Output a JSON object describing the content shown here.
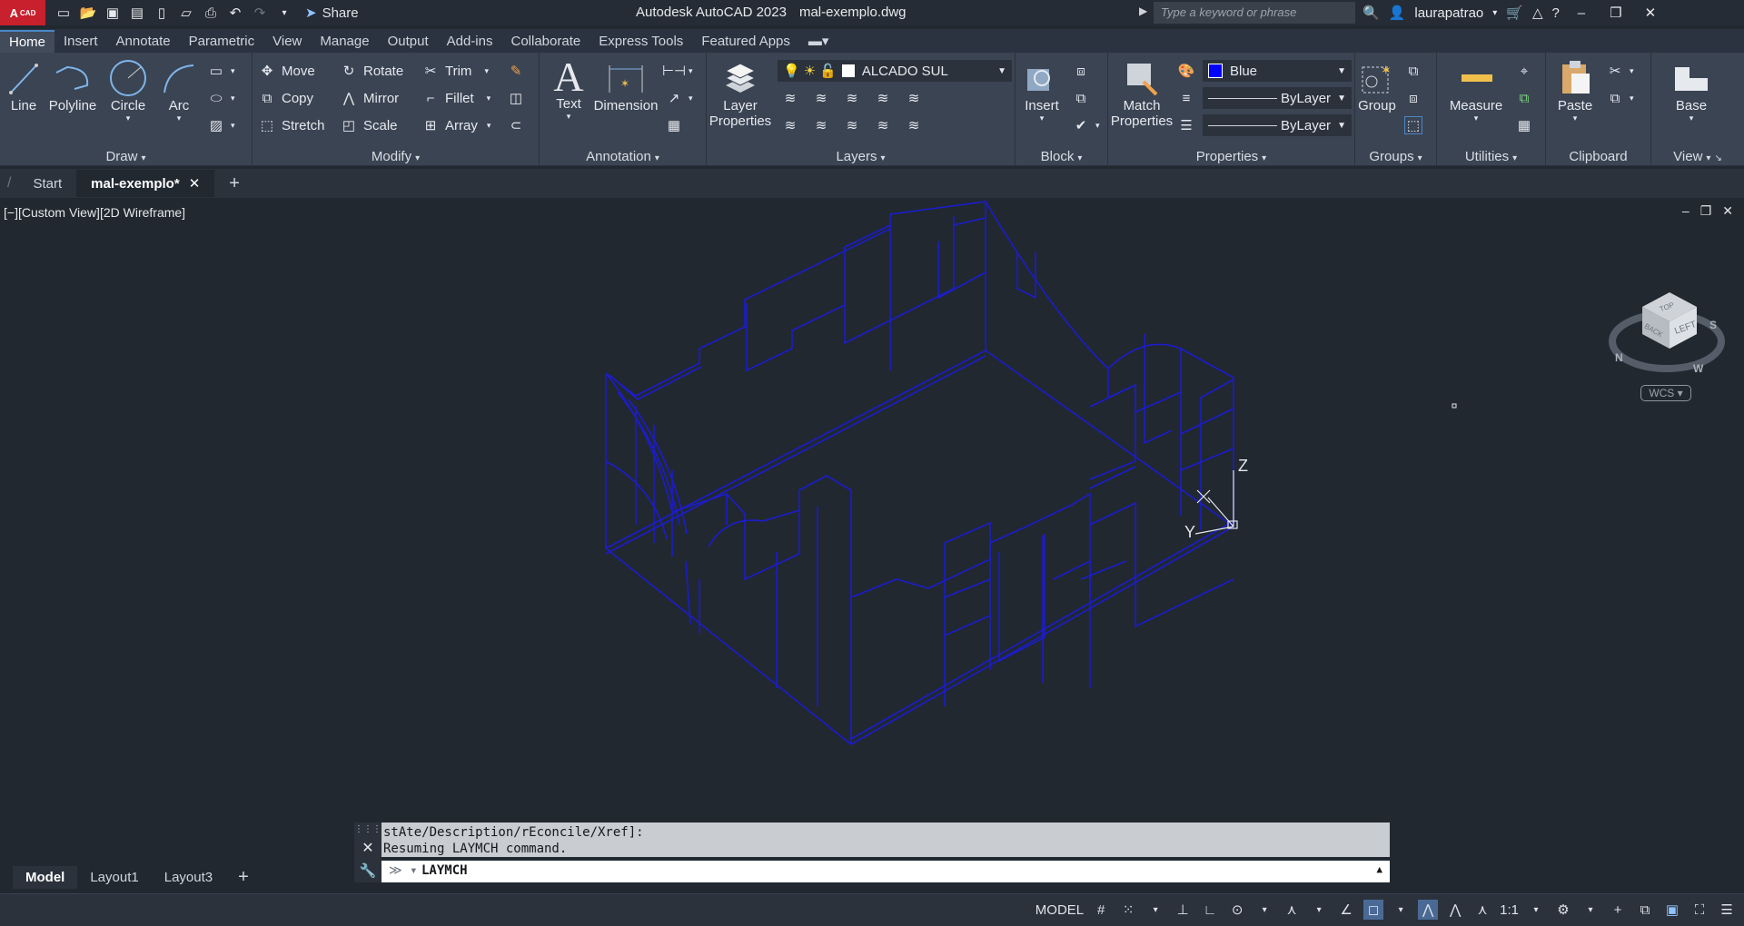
{
  "app": {
    "logo_text": "A",
    "logo_sub": "CAD",
    "title": "Autodesk AutoCAD 2023",
    "filename": "mal-exemplo.dwg",
    "share_label": "Share",
    "search_placeholder": "Type a keyword or phrase",
    "user": "laurapatrao"
  },
  "ribbon_tabs": [
    "Home",
    "Insert",
    "Annotate",
    "Parametric",
    "View",
    "Manage",
    "Output",
    "Add-ins",
    "Collaborate",
    "Express Tools",
    "Featured Apps"
  ],
  "panels": {
    "draw": {
      "title": "Draw",
      "line": "Line",
      "polyline": "Polyline",
      "circle": "Circle",
      "arc": "Arc"
    },
    "modify": {
      "title": "Modify",
      "move": "Move",
      "rotate": "Rotate",
      "trim": "Trim",
      "copy": "Copy",
      "mirror": "Mirror",
      "fillet": "Fillet",
      "stretch": "Stretch",
      "scale": "Scale",
      "array": "Array"
    },
    "annotation": {
      "title": "Annotation",
      "text": "Text",
      "dimension": "Dimension"
    },
    "layers": {
      "title": "Layers",
      "layer_properties_1": "Layer",
      "layer_properties_2": "Properties",
      "current_layer": "ALCADO SUL"
    },
    "block": {
      "title": "Block",
      "insert": "Insert"
    },
    "properties": {
      "title": "Properties",
      "match_1": "Match",
      "match_2": "Properties",
      "color": "Blue",
      "linetype": "ByLayer",
      "lineweight": "ByLayer"
    },
    "groups": {
      "title": "Groups",
      "group": "Group"
    },
    "utilities": {
      "title": "Utilities",
      "measure": "Measure"
    },
    "clipboard": {
      "title": "Clipboard",
      "paste": "Paste"
    },
    "view": {
      "title": "View",
      "base": "Base"
    }
  },
  "doc_tabs": {
    "start": "Start",
    "active": "mal-exemplo*"
  },
  "viewport": {
    "label": "[−][Custom View][2D Wireframe]",
    "viewcube_top": "TOP",
    "viewcube_left": "LEFT",
    "viewcube_back": "BACK",
    "compass": [
      "S",
      "N",
      "W"
    ],
    "wcs": "WCS",
    "axis_z": "Z",
    "axis_y": "Y"
  },
  "command": {
    "history_1": "stAte/Description/rEconcile/Xref]:",
    "history_2": "Resuming LAYMCH command.",
    "input": "LAYMCH"
  },
  "layout_tabs": [
    "Model",
    "Layout1",
    "Layout3"
  ],
  "status": {
    "model": "MODEL",
    "scale": "1:1"
  },
  "colors": {
    "drawing": "#1c1ccc",
    "accent": "#4a86c5",
    "layer_blue": "#0000ff"
  }
}
